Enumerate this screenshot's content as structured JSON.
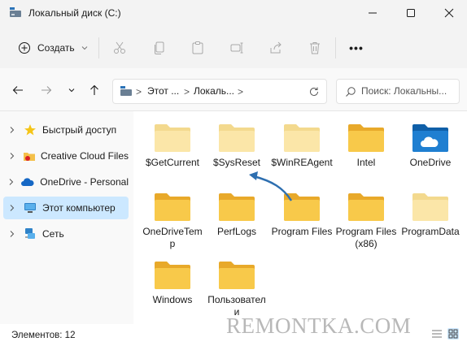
{
  "window": {
    "title": "Локальный диск (C:)",
    "icon": "drive-icon"
  },
  "toolbar": {
    "create_label": "Создать",
    "more_label": "•••",
    "icons": [
      "cut-icon",
      "copy-icon",
      "paste-icon",
      "rename-icon",
      "share-icon",
      "delete-icon"
    ]
  },
  "address": {
    "segments": [
      "Этот ...",
      "Локаль..."
    ],
    "separator": ">"
  },
  "search": {
    "placeholder": "Поиск: Локальны..."
  },
  "sidebar": {
    "items": [
      {
        "label": "Быстрый доступ",
        "icon": "star-icon"
      },
      {
        "label": "Creative Cloud Files",
        "icon": "creative-cloud-icon"
      },
      {
        "label": "OneDrive - Personal",
        "icon": "cloud-icon"
      },
      {
        "label": "Этот компьютер",
        "icon": "computer-icon",
        "selected": true
      },
      {
        "label": "Сеть",
        "icon": "network-icon"
      }
    ]
  },
  "folders": [
    {
      "name": "$GetCurrent",
      "style": "light"
    },
    {
      "name": "$SysReset",
      "style": "light"
    },
    {
      "name": "$WinREAgent",
      "style": "light"
    },
    {
      "name": "Intel",
      "style": "normal"
    },
    {
      "name": "OneDrive",
      "style": "onedrive"
    },
    {
      "name": "OneDriveTemp",
      "style": "normal"
    },
    {
      "name": "PerfLogs",
      "style": "normal"
    },
    {
      "name": "Program Files",
      "style": "normal"
    },
    {
      "name": "Program Files (x86)",
      "style": "normal"
    },
    {
      "name": "ProgramData",
      "style": "light"
    },
    {
      "name": "Windows",
      "style": "normal"
    },
    {
      "name": "Пользователи",
      "style": "normal"
    }
  ],
  "status": {
    "items_text": "Элементов: 12"
  },
  "watermark": "REMONTKA.COM",
  "colors": {
    "accent": "#1f6fb8",
    "folder_yellow": "#f7c948",
    "folder_light": "#fbe3a0",
    "selection": "#cce8ff",
    "arrow": "#2e6fb0"
  }
}
